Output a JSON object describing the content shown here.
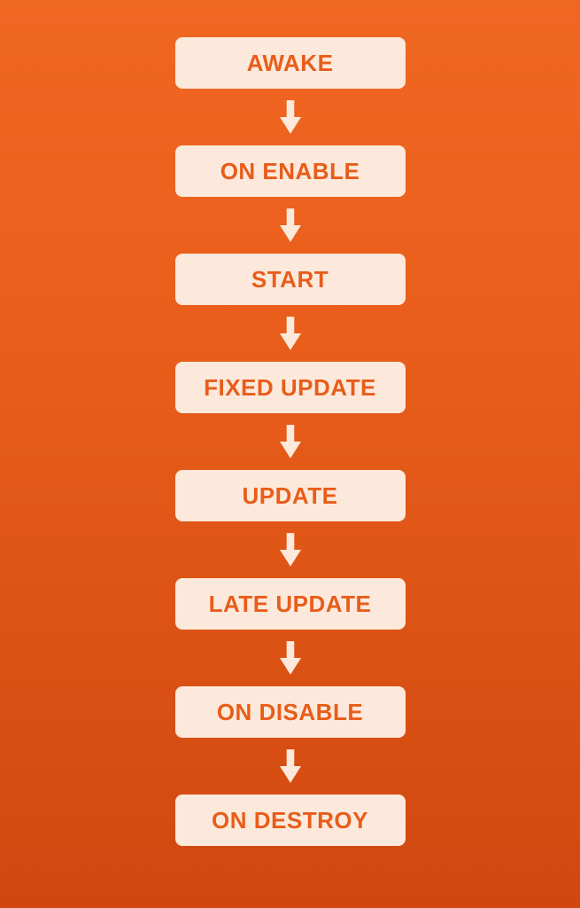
{
  "flowchart": {
    "steps": [
      "AWAKE",
      "ON ENABLE",
      "START",
      "FIXED UPDATE",
      "UPDATE",
      "LATE UPDATE",
      "ON DISABLE",
      "ON DESTROY"
    ]
  },
  "colors": {
    "background_top": "#f06722",
    "background_bottom": "#d04810",
    "box_fill": "#fce9db",
    "text": "#e85d1a",
    "arrow": "#fce9db"
  }
}
